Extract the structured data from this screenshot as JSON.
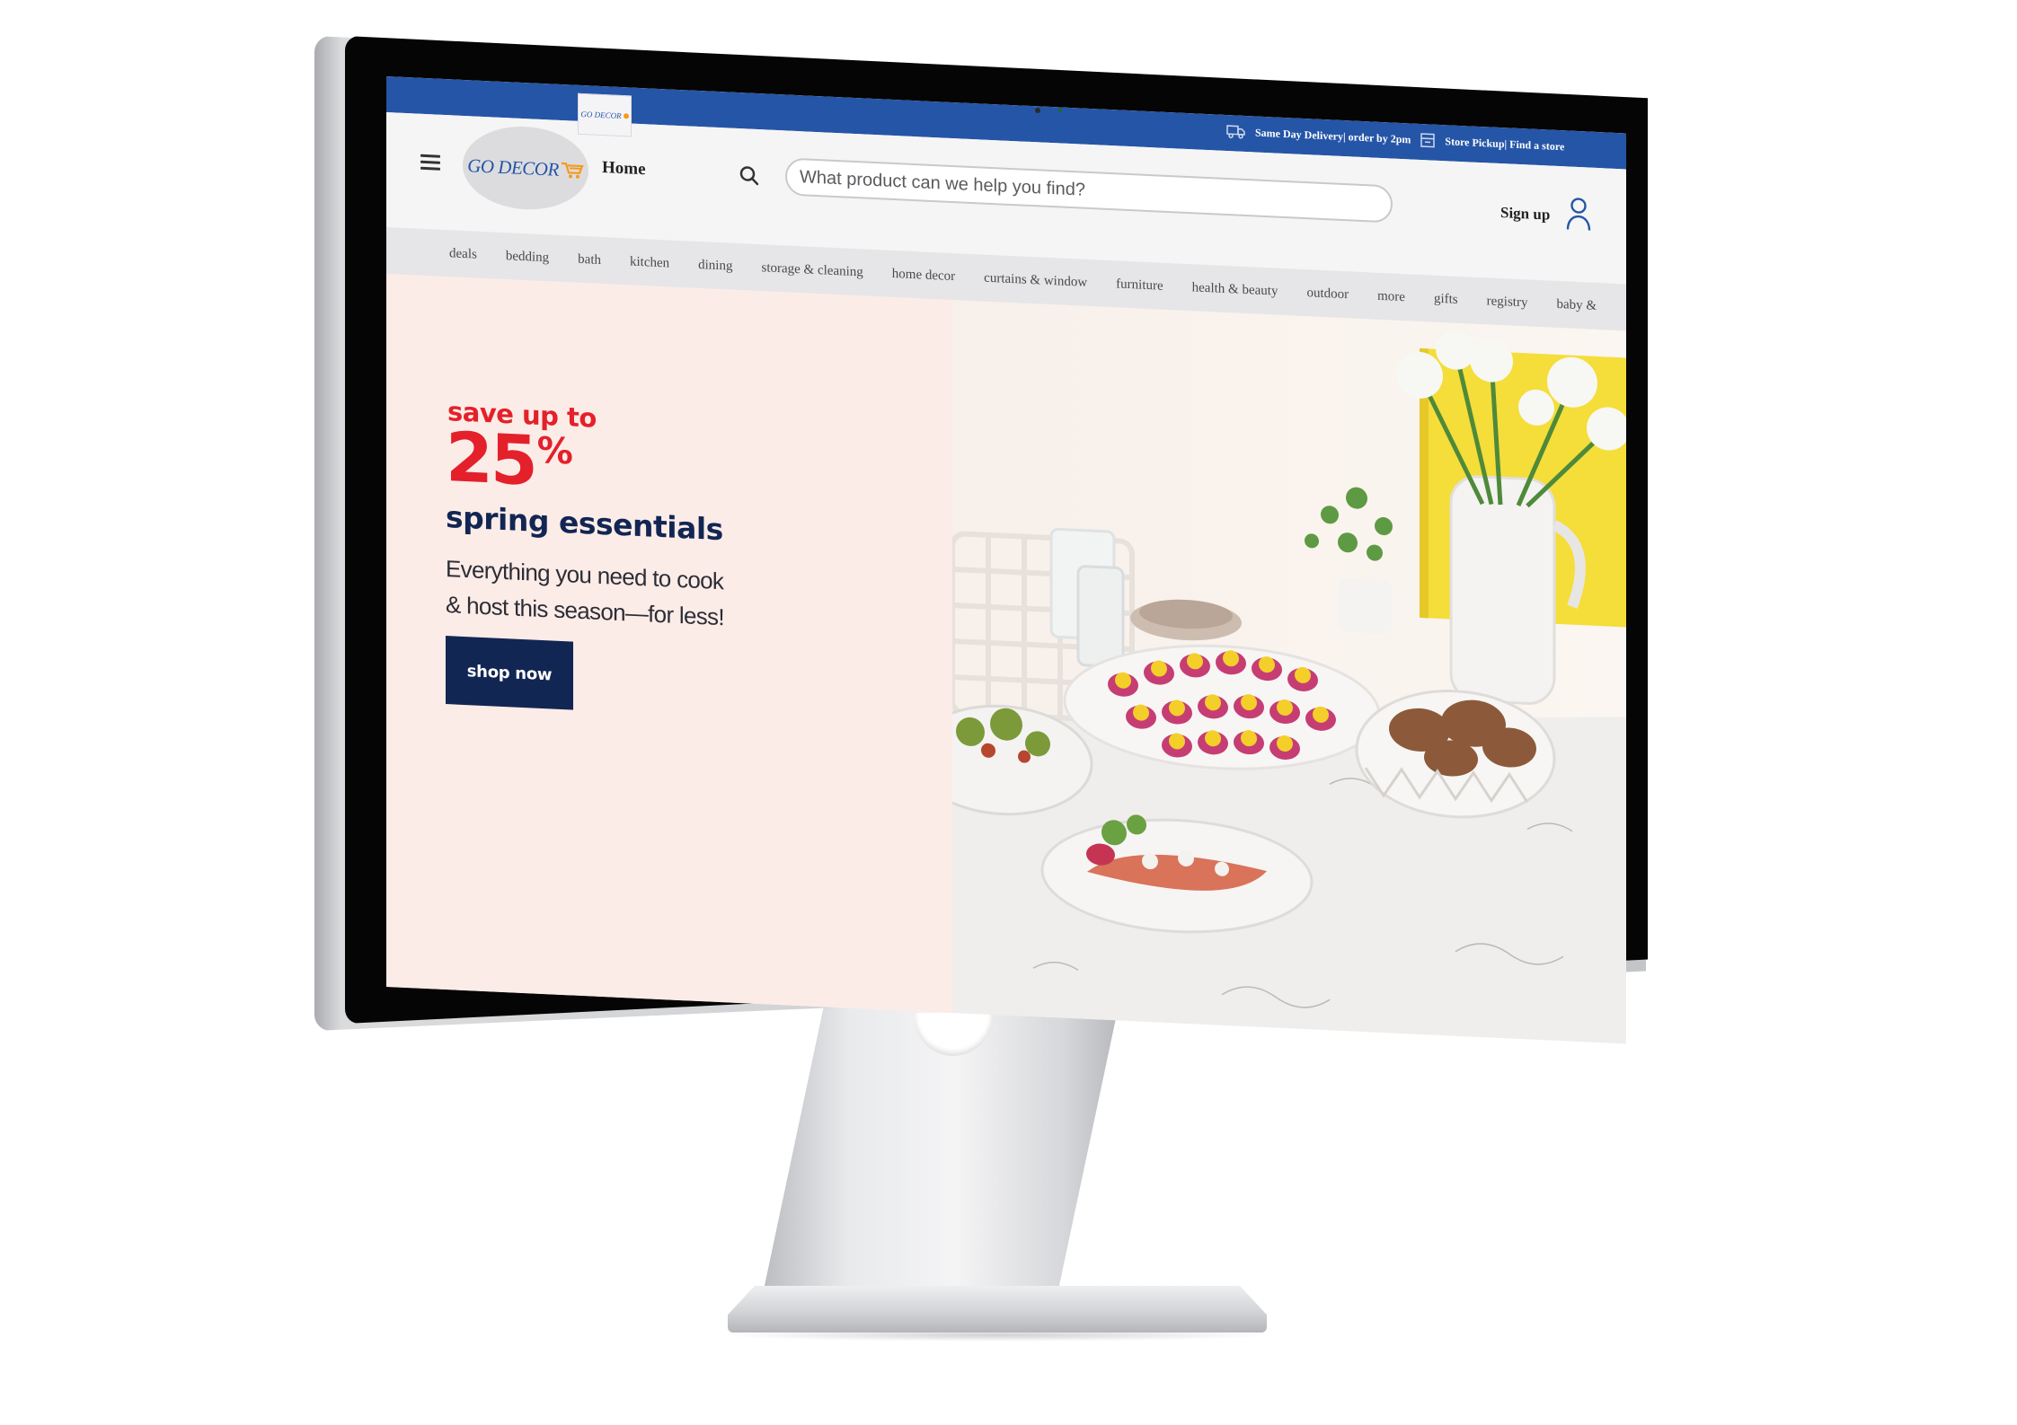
{
  "header": {
    "strip_logo_text": "GO DECOR",
    "logo_text": "GO DECOR",
    "home_label": "Home",
    "delivery_text": "Same Day Delivery| order by 2pm",
    "pickup_text": "Store Pickup| Find a store",
    "search_placeholder": "What product can we help you find?",
    "signup_label": "Sign up"
  },
  "nav": {
    "items": [
      "deals",
      "bedding",
      "bath",
      "kitchen",
      "dining",
      "storage & cleaning",
      "home decor",
      "curtains & window",
      "furniture",
      "health & beauty",
      "outdoor",
      "more",
      "gifts",
      "registry",
      "baby &"
    ]
  },
  "hero": {
    "save_text": "save up to",
    "percent_value": "25",
    "percent_sign": "%",
    "headline": "spring essentials",
    "subcopy_line1": "Everything you need to cook",
    "subcopy_line2": "& host this season—for less!",
    "cta_label": "shop now"
  },
  "colors": {
    "brand_blue": "#2555a6",
    "accent_red": "#e4202b",
    "navy": "#122654",
    "hero_bg": "#fcece7"
  },
  "icons": {
    "menu": "hamburger-icon",
    "cart": "cart-icon",
    "truck": "truck-icon",
    "store": "store-icon",
    "search": "search-icon",
    "user": "user-icon"
  }
}
